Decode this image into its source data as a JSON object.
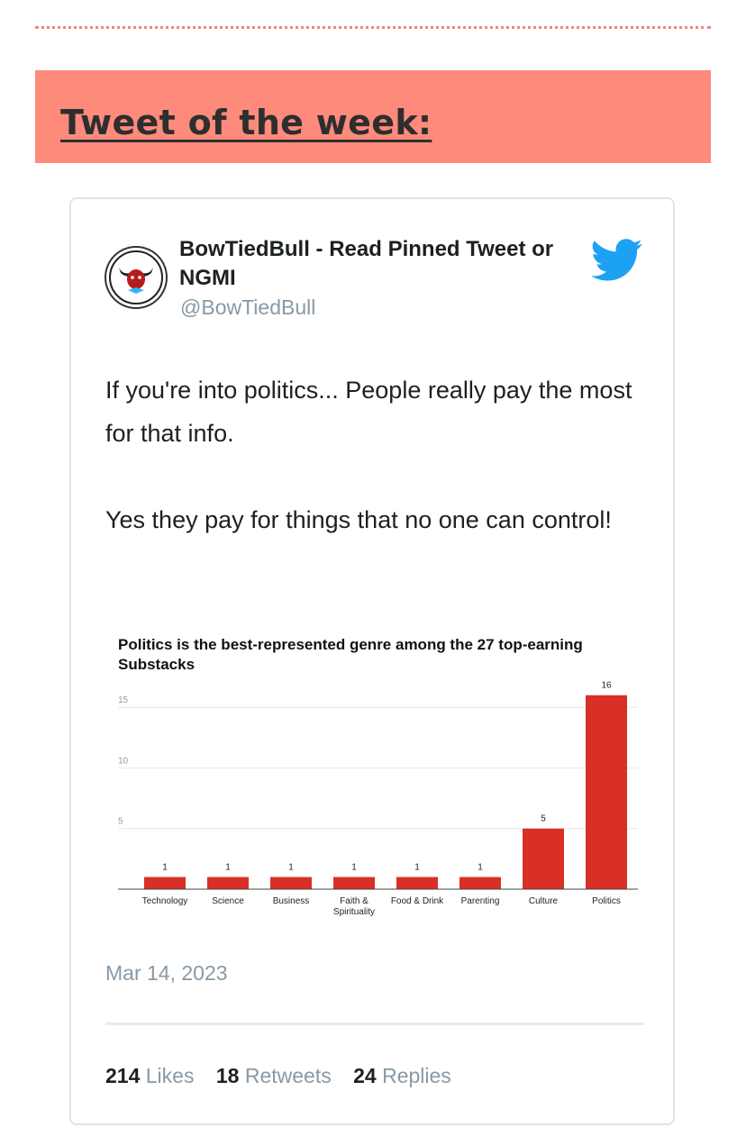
{
  "banner": {
    "title": "Tweet of the week:"
  },
  "tweet": {
    "author_name": "BowTiedBull - Read Pinned Tweet or NGMI",
    "handle": "@BowTiedBull",
    "paragraphs": [
      "If you're into politics... People really pay the most for that info.",
      "Yes they pay for things that no one can control!"
    ],
    "date": "Mar 14, 2023",
    "stats": {
      "likes_count": "214",
      "likes_label": "Likes",
      "retweets_count": "18",
      "retweets_label": "Retweets",
      "replies_count": "24",
      "replies_label": "Replies"
    }
  },
  "colors": {
    "banner": "#fe8a7c",
    "bar": "#d93025",
    "twitter": "#1da1f2",
    "muted": "#8899a6"
  },
  "icons": {
    "brand": "twitter-bird-icon",
    "avatar": "bull-avatar"
  },
  "chart_data": {
    "type": "bar",
    "title": "Politics is the best-represented genre among the 27 top-earning Substacks",
    "categories": [
      "Technology",
      "Science",
      "Business",
      "Faith & Spirituality",
      "Food & Drink",
      "Parenting",
      "Culture",
      "Politics"
    ],
    "category_lines": [
      [
        "Technology"
      ],
      [
        "Science"
      ],
      [
        "Business"
      ],
      [
        "Faith &",
        "Spirituality"
      ],
      [
        "Food & Drink"
      ],
      [
        "Parenting"
      ],
      [
        "Culture"
      ],
      [
        "Politics"
      ]
    ],
    "values": [
      1,
      1,
      1,
      1,
      1,
      1,
      5,
      16
    ],
    "yticks": [
      5,
      10,
      15
    ],
    "ylim": [
      0,
      16.5
    ],
    "grid": true,
    "data_labels": true
  }
}
